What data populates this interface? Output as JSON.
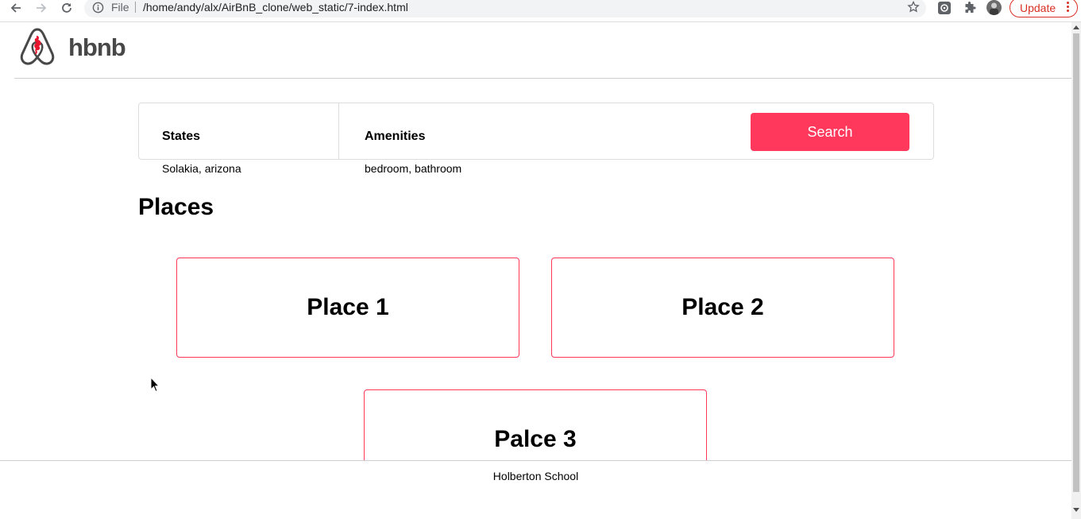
{
  "browser": {
    "scheme_label": "File",
    "url": "/home/andy/alx/AirBnB_clone/web_static/7-index.html",
    "update_label": "Update"
  },
  "header": {
    "logo_text": "hbnb"
  },
  "filters": {
    "states_title": "States",
    "states_selected": "Solakia, arizona",
    "amenities_title": "Amenities",
    "amenities_selected": "bedroom, bathroom",
    "search_label": "Search"
  },
  "places": {
    "title": "Places",
    "items": [
      {
        "name": "Place 1"
      },
      {
        "name": "Place 2"
      },
      {
        "name": "Palce 3"
      }
    ]
  },
  "footer": {
    "text": "Holberton School"
  },
  "colors": {
    "accent": "#ff385c",
    "update": "#d93025",
    "logo": "#484848"
  }
}
